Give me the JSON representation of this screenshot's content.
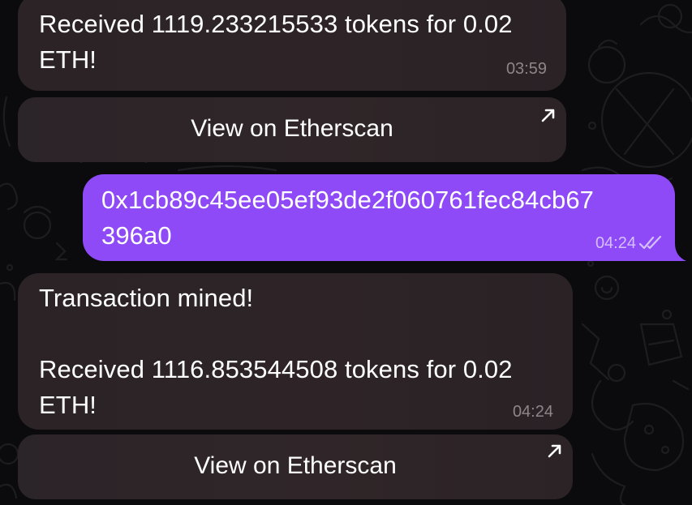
{
  "messages": [
    {
      "text": "Received 1119.233215533 tokens for 0.02\nETH!",
      "time": "03:59",
      "button_label": "View on Etherscan"
    },
    {
      "text": "0x1cb89c45ee05ef93de2f060761fec84cb67\n396a0",
      "time": "04:24",
      "status_icon": "double-check-icon"
    },
    {
      "text": "Transaction mined!\n\nReceived 1116.853544508 tokens for 0.02\nETH!",
      "time": "04:24",
      "button_label": "View on Etherscan"
    }
  ],
  "colors": {
    "background": "#0b0b0d",
    "incoming_bubble": "#2e2428",
    "outgoing_bubble": "#8f4af8",
    "timestamp": "#8d8689"
  },
  "icons": {
    "button_link": "arrow-up-right-icon"
  }
}
